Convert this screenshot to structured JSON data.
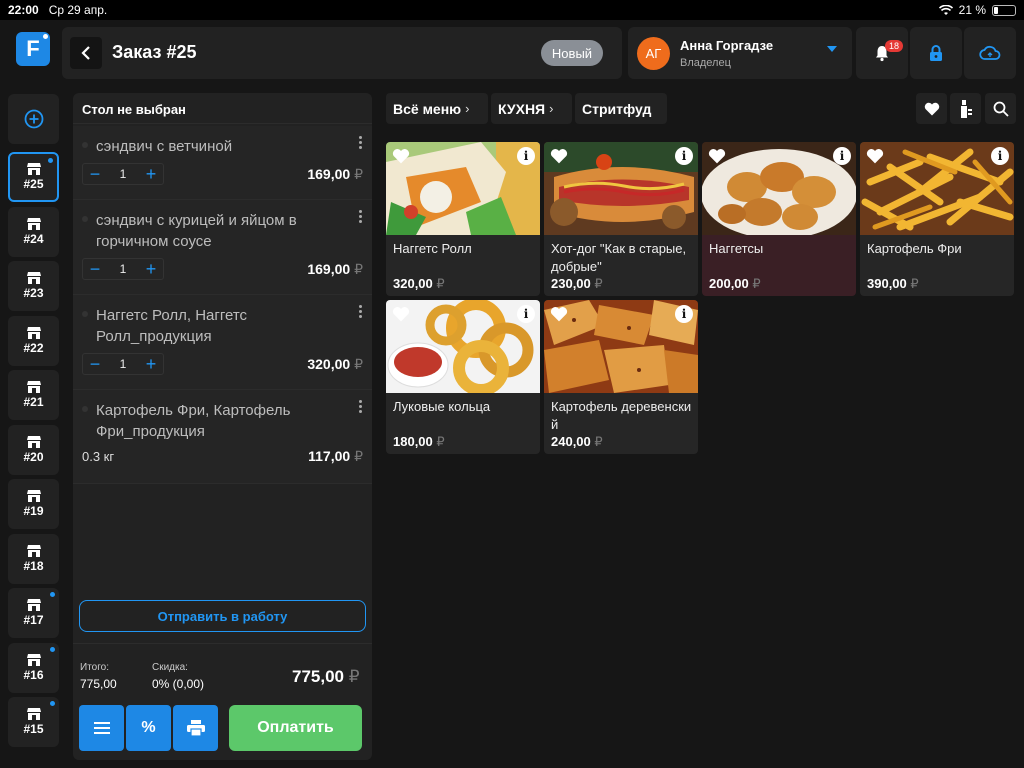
{
  "status_bar": {
    "time": "22:00",
    "date": "Ср 29 апр.",
    "battery": "21 %",
    "battery_level": 0.21
  },
  "header": {
    "logo_letter": "F",
    "order_title": "Заказ #25",
    "status": "Новый",
    "user": {
      "initials": "АГ",
      "name": "Анна Горгадзе",
      "role": "Владелец"
    },
    "notifications_count": "18"
  },
  "orders_rail": [
    "#25",
    "#24",
    "#23",
    "#22",
    "#21",
    "#20",
    "#19",
    "#18",
    "#17",
    "#16",
    "#15"
  ],
  "order_panel": {
    "table": "Стол не выбран",
    "currency": "₽",
    "items": [
      {
        "name": "сэндвич с ветчиной",
        "qty": "1",
        "price": "169,00"
      },
      {
        "name": "сэндвич с курицей и яйцом в горчичном соусе",
        "qty": "1",
        "price": "169,00"
      },
      {
        "name": "Наггетс Ролл, Наггетс Ролл_продукция",
        "qty": "1",
        "price": "320,00"
      },
      {
        "name": "Картофель Фри, Картофель Фри_продукция",
        "weight": "0.3 кг",
        "price": "117,00"
      }
    ],
    "send_label": "Отправить в работу",
    "total_label": "Итого:",
    "total_value": "775,00",
    "discount_label": "Скидка:",
    "discount_value": "0% (0,00)",
    "grand_total": "775,00",
    "pay_label": "Оплатить",
    "discount_button": "%"
  },
  "menu": {
    "breadcrumbs": [
      "Всё меню",
      "КУХНЯ",
      "Стритфуд"
    ],
    "products": [
      {
        "name": "Наггетс Ролл",
        "price": "320,00"
      },
      {
        "name": "Хот-дог \"Как в старые, добрые\"",
        "price": "230,00"
      },
      {
        "name": "Наггетсы",
        "price": "200,00"
      },
      {
        "name": "Картофель Фри",
        "price": "390,00"
      },
      {
        "name": "Луковые кольца",
        "price": "180,00"
      },
      {
        "name": "Картофель деревенский",
        "price": "240,00"
      }
    ]
  },
  "colors": {
    "accent": "#2196f3",
    "pay": "#5cc86a",
    "avatar": "#ef6c1c",
    "badge": "#e53935"
  }
}
